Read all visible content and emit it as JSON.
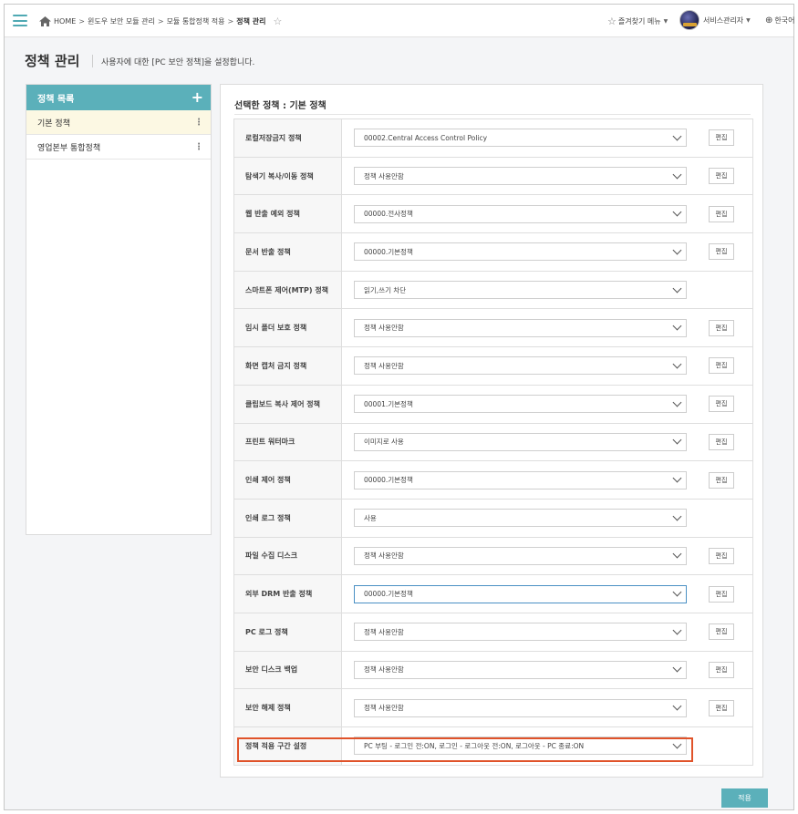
{
  "topbar": {
    "breadcrumb": [
      "HOME",
      "윈도우 보안 모듈 관리",
      "모듈 통합정책 적용",
      "정책 관리"
    ],
    "crumb_sep": ">",
    "favorites_label": "즐겨찾기 메뉴",
    "user_name": "서비스관리자",
    "language_label": "한국어"
  },
  "page": {
    "title": "정책 관리",
    "description": "사용자에 대한 [PC 보안 정책]을 설정합니다."
  },
  "policy_list": {
    "header": "정책 목록",
    "add_symbol": "+",
    "items": [
      {
        "label": "기본 정책",
        "active": true
      },
      {
        "label": "영업본부 통합정책",
        "active": false
      }
    ]
  },
  "selected_policy": {
    "title": "선택한 정책 : 기본 정책",
    "edit_label": "편집",
    "rows": [
      {
        "label": "로컬저장금지 정책",
        "value": "00002.Central Access Control Policy",
        "has_edit": true
      },
      {
        "label": "탐색기 복사/이동 정책",
        "value": "정책 사용안함",
        "has_edit": true
      },
      {
        "label": "웹 반출 예외 정책",
        "value": "00000.전사정책",
        "has_edit": true
      },
      {
        "label": "문서 반출 정책",
        "value": "00000.기본정책",
        "has_edit": true
      },
      {
        "label": "스마트폰 제어(MTP) 정책",
        "value": "읽기,쓰기 차단",
        "has_edit": false
      },
      {
        "label": "임시 폴더 보호 정책",
        "value": "정책 사용안함",
        "has_edit": true
      },
      {
        "label": "화면 캡처 금지 정책",
        "value": "정책 사용안함",
        "has_edit": true
      },
      {
        "label": "클립보드 복사 제어 정책",
        "value": "00001.기본정책",
        "has_edit": true
      },
      {
        "label": "프린트 워터마크",
        "value": "이미지로 사용",
        "has_edit": true
      },
      {
        "label": "인쇄 제어 정책",
        "value": "00000.기본정책",
        "has_edit": true
      },
      {
        "label": "인쇄 로그 정책",
        "value": "사용",
        "has_edit": false
      },
      {
        "label": "파일 수집 디스크",
        "value": "정책 사용안함",
        "has_edit": true
      },
      {
        "label": "외부 DRM 반출 정책",
        "value": "00000.기본정책",
        "has_edit": true,
        "focused": true
      },
      {
        "label": "PC 로그 정책",
        "value": "정책 사용안함",
        "has_edit": true
      },
      {
        "label": "보안 디스크 백업",
        "value": "정책 사용안함",
        "has_edit": true
      },
      {
        "label": "보안 해제 정책",
        "value": "정책 사용안함",
        "has_edit": true
      },
      {
        "label": "정책 적용 구간 설정",
        "value": "PC 부팅 - 로그인 전:ON, 로그인 - 로그아웃 전:ON, 로그아웃 - PC 종료:ON",
        "has_edit": false,
        "highlighted": true
      }
    ]
  },
  "apply_label": "적용",
  "colors": {
    "accent": "#5bb0ba",
    "highlight": "#e0532a",
    "active_item": "#fcf8e3"
  }
}
